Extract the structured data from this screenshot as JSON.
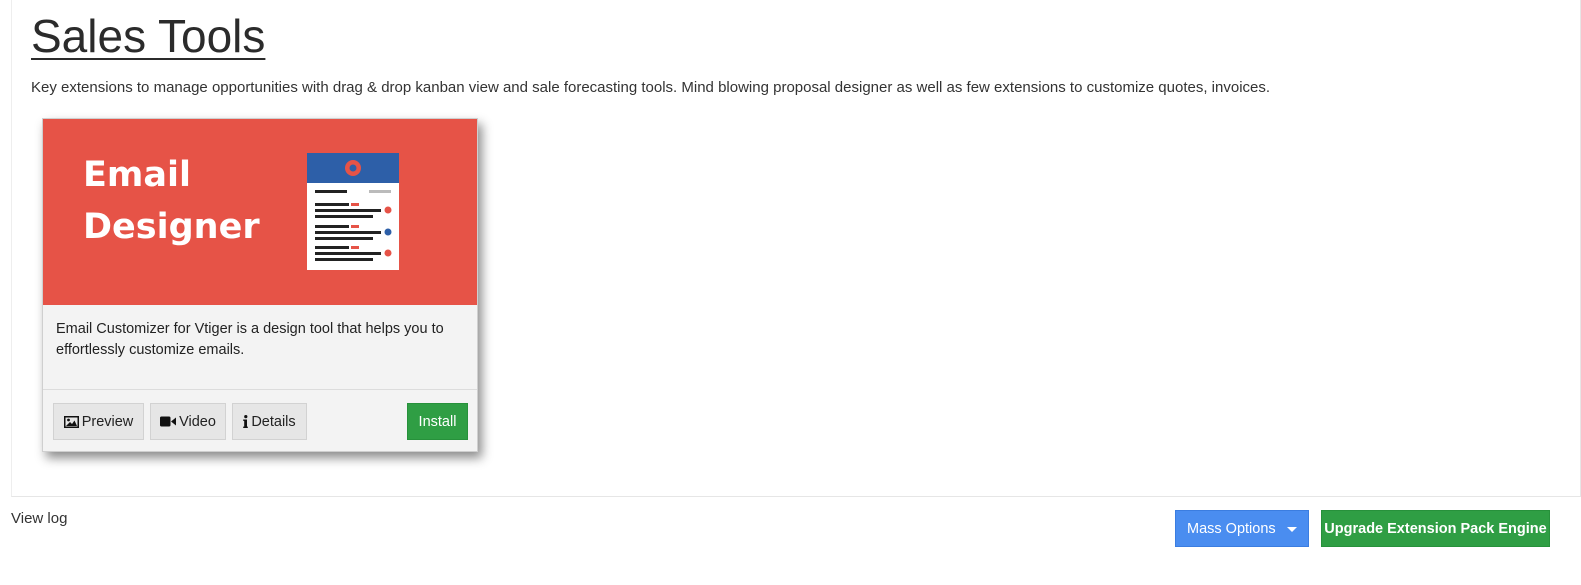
{
  "page": {
    "title": "Sales Tools",
    "description": "Key extensions to manage opportunities with drag & drop kanban view and sale forecasting tools. Mind blowing proposal designer as well as few extensions to customize quotes, invoices."
  },
  "cards": [
    {
      "banner_title_line1": "Email",
      "banner_title_line2": "Designer",
      "banner_color": "#e65347",
      "description": "Email Customizer for Vtiger is a design tool that helps you to effortlessly customize emails.",
      "buttons": {
        "preview": {
          "label": "Preview",
          "icon": "image-icon"
        },
        "video": {
          "label": "Video",
          "icon": "video-camera-icon"
        },
        "details": {
          "label": "Details",
          "icon": "info-icon"
        },
        "install": {
          "label": "Install"
        }
      }
    }
  ],
  "footer": {
    "view_log": "View log",
    "mass_options": "Mass Options",
    "upgrade": "Upgrade Extension Pack Engine"
  },
  "colors": {
    "primary_blue": "#4a8df0",
    "success_green": "#2f9e44"
  }
}
